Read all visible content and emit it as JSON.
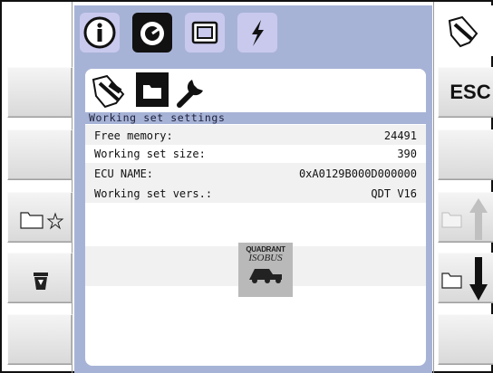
{
  "tabs": [
    {
      "icon": "info-icon"
    },
    {
      "icon": "gauge-icon"
    },
    {
      "icon": "display-icon"
    },
    {
      "icon": "lightning-icon"
    }
  ],
  "panel": {
    "title": "Working set settings",
    "rows": [
      {
        "label": "Free memory:",
        "value": "24491"
      },
      {
        "label": "Working set size:",
        "value": "390"
      },
      {
        "label": "ECU NAME:",
        "value": "0xA0129B000D000000"
      },
      {
        "label": "Working set vers.:",
        "value": "QDT V16"
      }
    ],
    "logo": {
      "line1": "QUADRANT",
      "line2": "ISOBUS"
    }
  },
  "right_softkeys": {
    "esc_label": "ESC"
  },
  "colors": {
    "accent": "#a7b3d6",
    "tab_active": "#111111",
    "tab_inactive": "#c9c9ee"
  }
}
